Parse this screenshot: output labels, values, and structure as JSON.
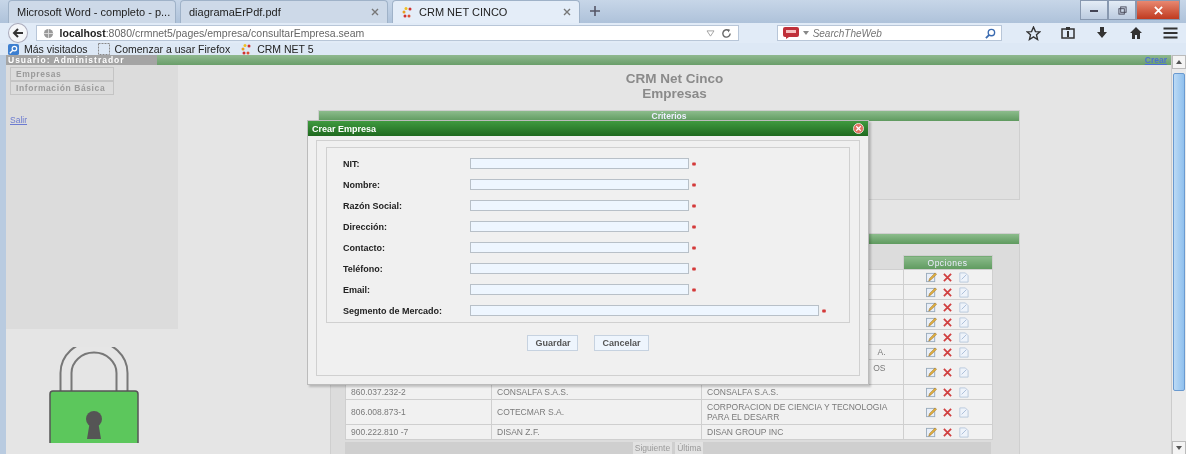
{
  "browser": {
    "tabs": [
      {
        "label": "Microsoft Word - completo - p...",
        "selected": false
      },
      {
        "label": "diagramaErPdf.pdf",
        "selected": false
      },
      {
        "label": "CRM NET CINCO",
        "selected": true
      }
    ],
    "url": "**localhost**:8080/crmnet5/pages/empresa/consultarEmpresa.seam",
    "search": {
      "placeholder": "SearchTheWeb"
    },
    "bookmarks": [
      "Más visitados",
      "Comenzar a usar Firefox",
      "CRM NET 5"
    ]
  },
  "top_bar": {
    "user": "Usuario: Administrador",
    "link": "Crear"
  },
  "sidebar": {
    "items": [
      "Empresas",
      "Información Básica"
    ],
    "logout": "Salir"
  },
  "header": {
    "title": "CRM Net Cinco",
    "subtitle": "Empresas"
  },
  "criteria_panel": {
    "title": "Criterios"
  },
  "results": {
    "options_header": "Opciones",
    "rows": [
      {},
      {},
      {},
      {},
      {},
      {
        "razon_social_tail": "A."
      },
      {
        "razon_social_tail": "OS"
      },
      {
        "nit": "860.037.232-2",
        "nombre": "CONSALFA S.A.S.",
        "razon_social": "CONSALFA S.A.S."
      },
      {
        "nit": "806.008.873-1",
        "nombre": "COTECMAR S.A.",
        "razon_social": "CORPORACION DE CIENCIA Y TECNOLOGIA PARA EL DESARR"
      },
      {
        "nit": "900.222.810 -7",
        "nombre": "DISAN Z.F.",
        "razon_social": "DISAN GROUP INC"
      }
    ],
    "pager": [
      "Siguiente",
      "Última"
    ]
  },
  "modal": {
    "title": "Crear Empresa",
    "fields": [
      {
        "label": "NIT:",
        "kind": "short",
        "required": true
      },
      {
        "label": "Nombre:",
        "kind": "short",
        "required": true
      },
      {
        "label": "Razón Social:",
        "kind": "short",
        "required": true
      },
      {
        "label": "Dirección:",
        "kind": "short",
        "required": true
      },
      {
        "label": "Contacto:",
        "kind": "short",
        "required": true
      },
      {
        "label": "Teléfono:",
        "kind": "short",
        "required": true
      },
      {
        "label": "Email:",
        "kind": "short",
        "required": true
      },
      {
        "label": "Segmento de Mercado:",
        "kind": "long",
        "required": true
      }
    ],
    "buttons": [
      "Guardar",
      "Cancelar"
    ]
  }
}
